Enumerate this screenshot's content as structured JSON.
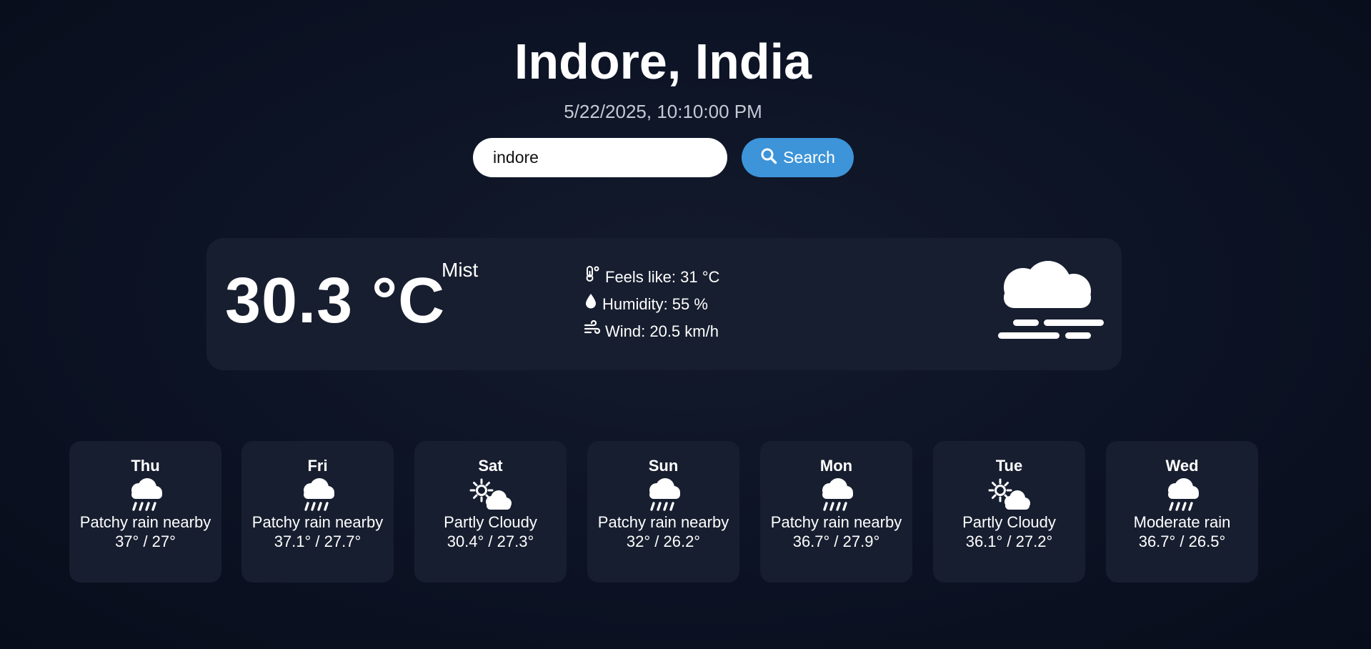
{
  "header": {
    "city": "Indore, India",
    "datetime": "5/22/2025, 10:10:00 PM"
  },
  "search": {
    "value": "indore",
    "button_label": "Search",
    "button_icon": "search-icon",
    "button_color": "#3d94d8"
  },
  "current": {
    "temperature": "30.3 °C",
    "condition": "Mist",
    "condition_icon": "mist-icon",
    "feels_like": "Feels like: 31 °C",
    "humidity": "Humidity: 55 %",
    "wind": "Wind: 20.5 km/h"
  },
  "forecast": [
    {
      "day": "Thu",
      "condition": "Patchy rain nearby",
      "temps": "37° / 27°",
      "icon": "rain-cloud-icon"
    },
    {
      "day": "Fri",
      "condition": "Patchy rain nearby",
      "temps": "37.1° / 27.7°",
      "icon": "rain-cloud-icon"
    },
    {
      "day": "Sat",
      "condition": "Partly Cloudy",
      "temps": "30.4° / 27.3°",
      "icon": "partly-cloudy-icon"
    },
    {
      "day": "Sun",
      "condition": "Patchy rain nearby",
      "temps": "32° / 26.2°",
      "icon": "rain-cloud-icon"
    },
    {
      "day": "Mon",
      "condition": "Patchy rain nearby",
      "temps": "36.7° / 27.9°",
      "icon": "rain-cloud-icon"
    },
    {
      "day": "Tue",
      "condition": "Partly Cloudy",
      "temps": "36.1° / 27.2°",
      "icon": "partly-cloudy-icon"
    },
    {
      "day": "Wed",
      "condition": "Moderate rain",
      "temps": "36.7° / 26.5°",
      "icon": "rain-cloud-icon"
    }
  ],
  "colors": {
    "background": "#0d1426",
    "card": "#171e2f",
    "accent": "#3d94d8"
  }
}
